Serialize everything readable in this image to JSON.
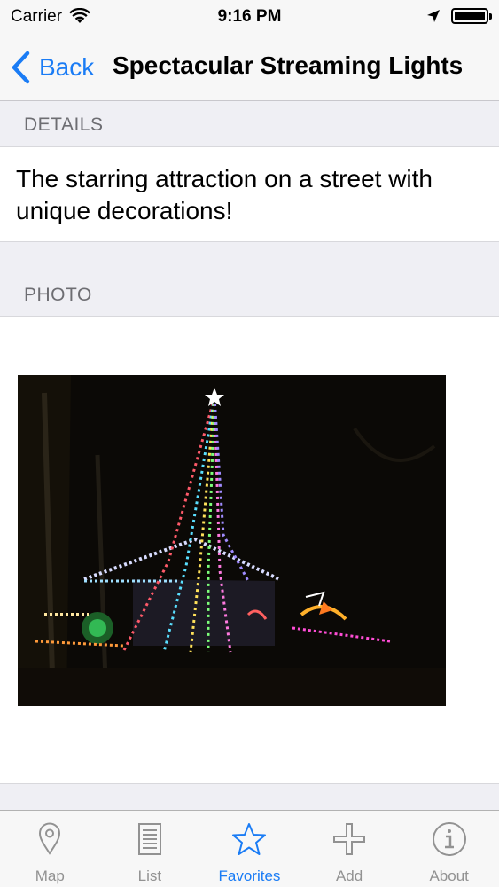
{
  "status_bar": {
    "carrier": "Carrier",
    "time": "9:16 PM",
    "icons": [
      "wifi-icon",
      "location-arrow-icon",
      "battery-icon"
    ]
  },
  "nav": {
    "back_label": "Back",
    "title": "Spectacular Streaming Lights"
  },
  "sections": {
    "details_header": "DETAILS",
    "details_text": "The starring attraction on a street with unique decorations!",
    "photo_header": "PHOTO"
  },
  "tabs": [
    {
      "label": "Map",
      "icon": "map-pin-icon"
    },
    {
      "label": "List",
      "icon": "list-icon"
    },
    {
      "label": "Favorites",
      "icon": "star-icon",
      "selected": true
    },
    {
      "label": "Add",
      "icon": "plus-icon"
    },
    {
      "label": "About",
      "icon": "info-icon"
    }
  ],
  "colors": {
    "accent": "#1a7cf5",
    "tab_inactive": "#929292",
    "group_background": "#efeff4",
    "bar_background": "#f7f7f7"
  }
}
